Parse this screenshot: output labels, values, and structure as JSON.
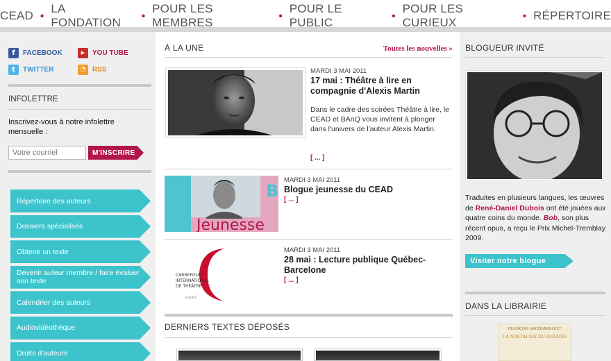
{
  "topnav": {
    "items": [
      "CEAD",
      "LA FONDATION",
      "POUR LES MEMBRES",
      "POUR LE PUBLIC",
      "POUR LES CURIEUX",
      "RÉPERTOIRE"
    ],
    "separator": "•"
  },
  "social": {
    "facebook": "FACEBOOK",
    "youtube": "YOU TUBE",
    "twitter": "TWITTER",
    "rss": "RSS"
  },
  "newsletter": {
    "title": "INFOLETTRE",
    "description": "Inscrivez-vous à notre infolettre mensuelle :",
    "placeholder": "Votre courriel",
    "button": "M'INSCRIRE"
  },
  "left_menu": [
    "Répertoire des auteurs",
    "Dossiers spécialisés",
    "Obtenir un texte",
    "Devenir auteur membre / faire évaluer son texte",
    "Calendrier des auteurs",
    "Audiovidéothèque",
    "Droits d'auteurs"
  ],
  "headline": {
    "title": "À LA UNE",
    "all_news": "Toutes les nouvelles »"
  },
  "articles": [
    {
      "date": "MARDI 3 MAI 2011",
      "title": "17 mai : Théâtre à lire en compagnie d'Alexis Martin",
      "body": "Dans le cadre des soirées Théâtre à lire, le CEAD et BAnQ vous invitent à plonger dans l'univers de l'auteur Alexis Martin.",
      "more": "[ ... ]"
    },
    {
      "date": "MARDI 3 MAI 2011",
      "title": "Blogue jeunesse du CEAD",
      "more": "[ ... ]",
      "image_text": "Jeunesse",
      "image_letter": "B"
    },
    {
      "date": "MARDI 3 MAI 2011",
      "title": "28 mai : Lecture publique Québec-Barcelone",
      "more": "[ ... ]",
      "logo_lines": [
        "CARREFOUR",
        "INTERNATIONAL",
        "DE THÉÂTRE"
      ],
      "logo_sub": "QUÉBEC"
    }
  ],
  "latest_texts": {
    "title": "DERNIERS TEXTES DÉPOSÉS"
  },
  "guest_blogger": {
    "title": "BLOGUEUR INVITÉ",
    "text_before": "Traduites en plusieurs langues, les œuvres de ",
    "author": "René-Daniel Dubois",
    "text_middle": " ont été jouées aux quatre coins du monde. ",
    "work": "Bob",
    "text_after": ", son plus récent opus, a reçu le Prix Michel-Tremblay 2009.",
    "button": "Visiter notre blogue"
  },
  "bookstore": {
    "title": "DANS LA LIBRAIRIE",
    "book_author": "FRANÇOIS ARCHAMBAULT",
    "book_title": "LA NOSTALGIE DU PARADIS"
  },
  "colors": {
    "accent": "#b3174a",
    "teal": "#3cc3cc",
    "link_blue": "#2b5d9e"
  }
}
